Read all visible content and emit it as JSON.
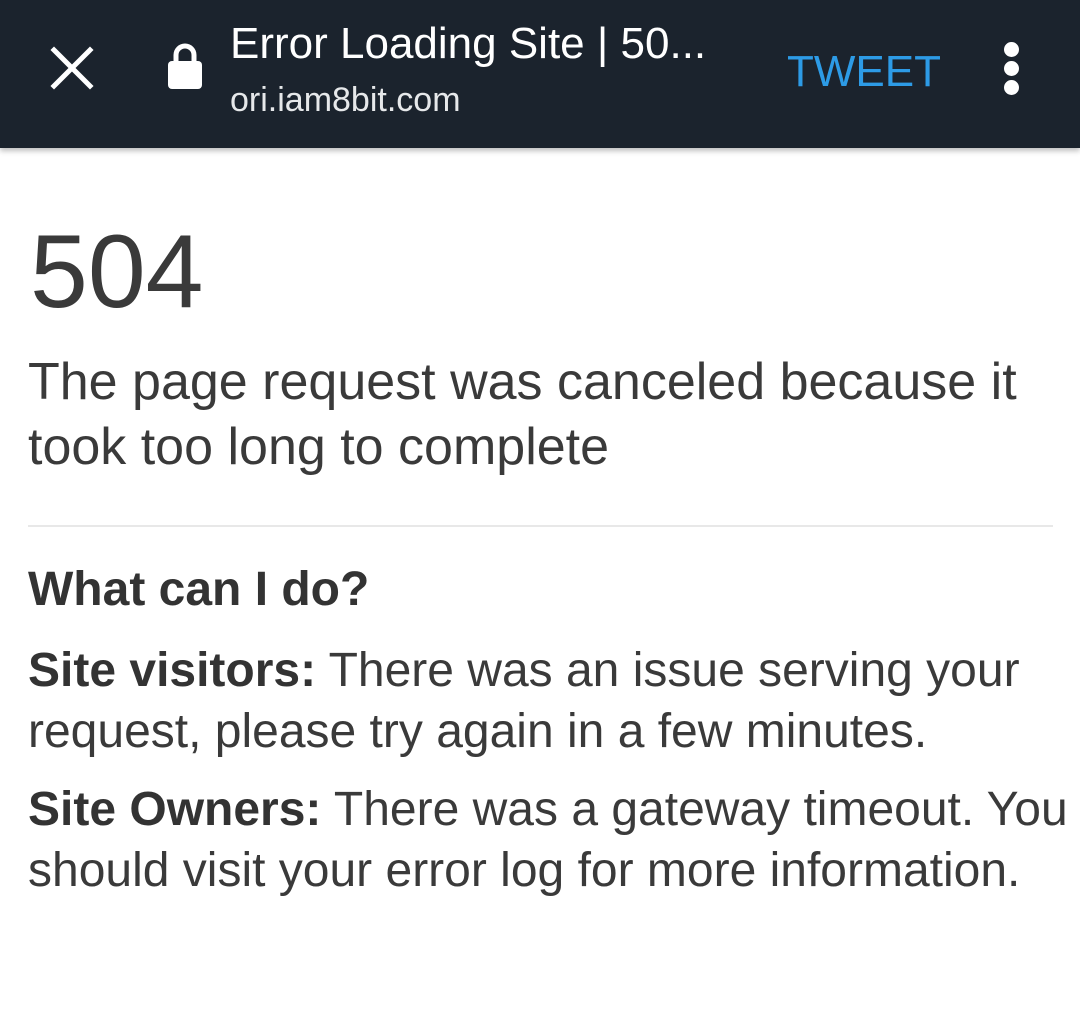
{
  "toolbar": {
    "title": "Error Loading Site | 50...",
    "url": "ori.iam8bit.com",
    "tweet_label": "TWEET",
    "icons": [
      "close-icon",
      "lock-icon",
      "more-vert-icon"
    ],
    "colors": {
      "background": "#1b232d",
      "tweet": "#2d9be6"
    }
  },
  "error": {
    "code": "504",
    "message": "The page request was canceled because it took too long to complete"
  },
  "help": {
    "heading": "What can I do?",
    "visitors_label": "Site visitors:",
    "visitors_text": " There was an issue serving your request, please try again in a few minutes.",
    "owners_label": "Site Owners:",
    "owners_text": " There was a gateway timeout. You should visit your error log for more information."
  }
}
